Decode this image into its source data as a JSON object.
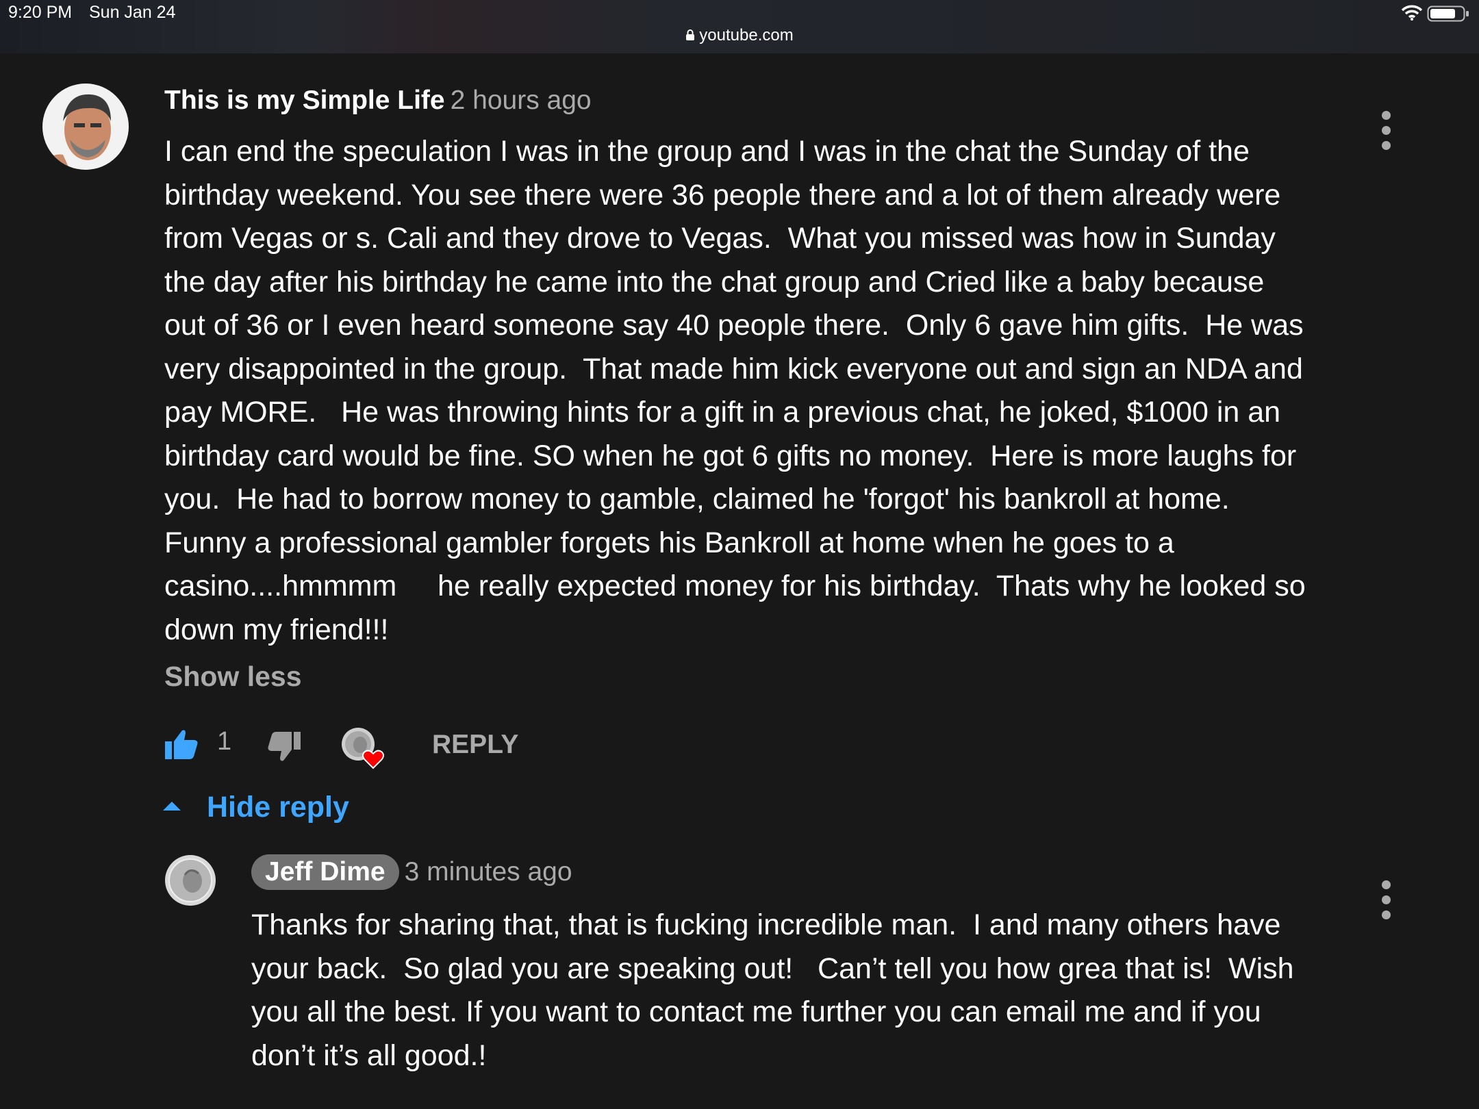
{
  "status_bar": {
    "time": "9:20 PM",
    "date": "Sun Jan 24",
    "url": "youtube.com"
  },
  "comment": {
    "author": "This is my Simple Life",
    "time": "2 hours ago",
    "lines": [
      "I can end the speculation I was in the group and I was in the chat the Sunday of the",
      "birthday weekend. You see there were 36 people there and a lot of them already were",
      "from Vegas or s. Cali and they drove to Vegas.  What you missed was how in Sunday",
      "the day after his birthday he came into the chat group and Cried like a baby because",
      "out of 36 or I even heard someone say 40 people there.  Only 6 gave him gifts.  He was",
      "very disappointed in the group.  That made him kick everyone out and sign an NDA and",
      "pay MORE.   He was throwing hints for a gift in a previous chat, he joked, $1000 in an",
      "birthday card would be fine. SO when he got 6 gifts no money.  Here is more laughs for",
      "you.  He had to borrow money to gamble, claimed he 'forgot' his bankroll at home.",
      "Funny a professional gambler forgets his Bankroll at home when he goes to a",
      "casino....hmmmm     he really expected money for his birthday.  Thats why he looked so",
      "down my friend!!!"
    ],
    "show_less": "Show less",
    "like_count": "1",
    "reply_label": "REPLY",
    "hide_reply_label": "Hide reply"
  },
  "reply": {
    "author": "Jeff Dime",
    "time": "3 minutes ago",
    "lines": [
      "Thanks for sharing that, that is fucking incredible man.  I and many others have",
      "your back.  So glad you are speaking out!   Can’t tell you how grea that is!  Wish",
      "you all the best. If you want to contact me further you can email me and if you",
      "don’t it’s all good.!"
    ]
  },
  "colors": {
    "background": "#181818",
    "secondary_text": "#aaaaaa",
    "link_blue": "#3ea6ff",
    "like_blue": "#3ea6ff",
    "heart_red": "#ff0000"
  },
  "icons": [
    "lock-icon",
    "wifi-icon",
    "battery-icon",
    "more-vert-icon",
    "thumb-up-icon",
    "thumb-down-icon",
    "creator-heart-icon",
    "caret-up-icon"
  ]
}
